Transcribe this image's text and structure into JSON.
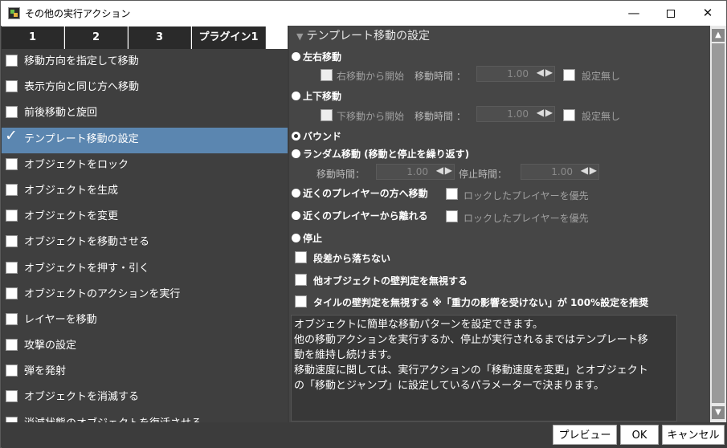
{
  "window": {
    "title": "その他の実行アクション"
  },
  "tabs": [
    "1",
    "2",
    "3",
    "プラグイン1"
  ],
  "actions": [
    {
      "label": "移動方向を指定して移動",
      "checked": false
    },
    {
      "label": "表示方向と同じ方へ移動",
      "checked": false
    },
    {
      "label": "前後移動と旋回",
      "checked": false
    },
    {
      "label": "テンプレート移動の設定",
      "checked": true
    },
    {
      "label": "オブジェクトをロック",
      "checked": false
    },
    {
      "label": "オブジェクトを生成",
      "checked": false
    },
    {
      "label": "オブジェクトを変更",
      "checked": false
    },
    {
      "label": "オブジェクトを移動させる",
      "checked": false
    },
    {
      "label": "オブジェクトを押す・引く",
      "checked": false
    },
    {
      "label": "オブジェクトのアクションを実行",
      "checked": false
    },
    {
      "label": "レイヤーを移動",
      "checked": false
    },
    {
      "label": "攻撃の設定",
      "checked": false
    },
    {
      "label": "弾を発射",
      "checked": false
    },
    {
      "label": "オブジェクトを消滅する",
      "checked": false
    },
    {
      "label": "消滅状態のオブジェクトを復活させる",
      "checked": false
    }
  ],
  "settings": {
    "section_title": "テンプレート移動の設定",
    "lr": {
      "label": "左右移動",
      "start_label": "右移動から開始",
      "time_label": "移動時間 ：",
      "time_value": "1.00",
      "none_label": "設定無し"
    },
    "ud": {
      "label": "上下移動",
      "start_label": "下移動から開始",
      "time_label": "移動時間 ：",
      "time_value": "1.00",
      "none_label": "設定無し"
    },
    "bound_label": "バウンド",
    "random": {
      "label": "ランダム移動 (移動と停止を繰り返す)",
      "move_time_label": "移動時間：",
      "move_time_value": "1.00",
      "stop_time_label": "停止時間：",
      "stop_time_value": "1.00"
    },
    "near_to": {
      "label": "近くのプレイヤーの方へ移動",
      "lock_label": "ロックしたプレイヤーを優先"
    },
    "near_away": {
      "label": "近くのプレイヤーから離れる",
      "lock_label": "ロックしたプレイヤーを優先"
    },
    "stop_label": "停止",
    "no_fall_label": "段差から落ちない",
    "ignore_wall_label": "他オブジェクトの壁判定を無視する",
    "ignore_tile_label": "タイルの壁判定を無視する ※「重力の影響を受けない」が 100%設定を推奨",
    "description": [
      "オブジェクトに簡単な移動パターンを設定できます。",
      "他の移動アクションを実行するか、停止が実行されるまではテンプレート移",
      "動を維持し続けます。",
      "移動速度に関しては、実行アクションの「移動速度を変更」とオブジェクト",
      "の「移動とジャンプ」に設定しているパラメーターで決まります。"
    ]
  },
  "footer": {
    "preview": "プレビュー",
    "ok": "OK",
    "cancel": "キャンセル"
  }
}
